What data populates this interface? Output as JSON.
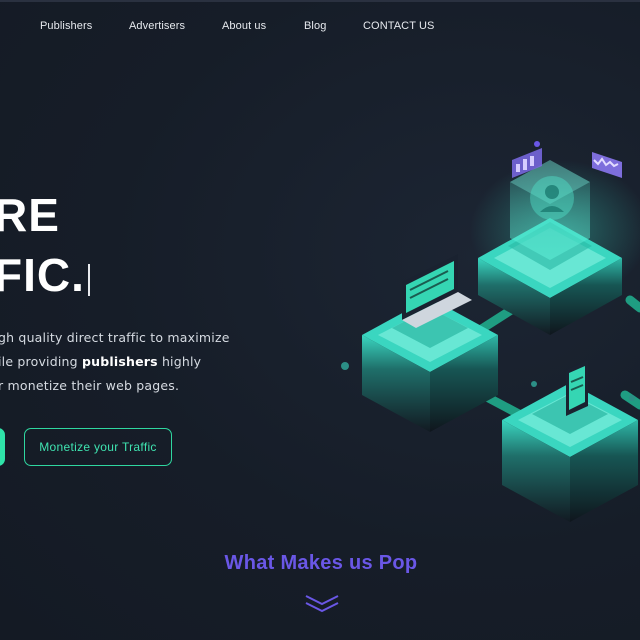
{
  "nav": {
    "items": [
      {
        "label": "Publishers"
      },
      {
        "label": "Advertisers"
      },
      {
        "label": "About us"
      },
      {
        "label": "Blog"
      },
      {
        "label": "CONTACT US"
      }
    ]
  },
  "hero": {
    "headline_line1": "RE",
    "headline_line2": "FIC.",
    "desc_line1": "gh quality direct traffic to maximize",
    "desc_line2_pre": "ile providing ",
    "desc_line2_bold": "publishers",
    "desc_line2_post": " highly",
    "desc_line3": "r monetize their web pages.",
    "cta_monetize": "Monetize your Traffic"
  },
  "section": {
    "title": "What Makes us Pop"
  },
  "icons": {
    "illustration": "isometric-network-illustration",
    "scroll": "double-chevron-down-icon"
  },
  "colors": {
    "background": "#161d28",
    "accent_green": "#2fe3a9",
    "accent_purple": "#6a57e6",
    "teal": "#3ad6c0"
  }
}
